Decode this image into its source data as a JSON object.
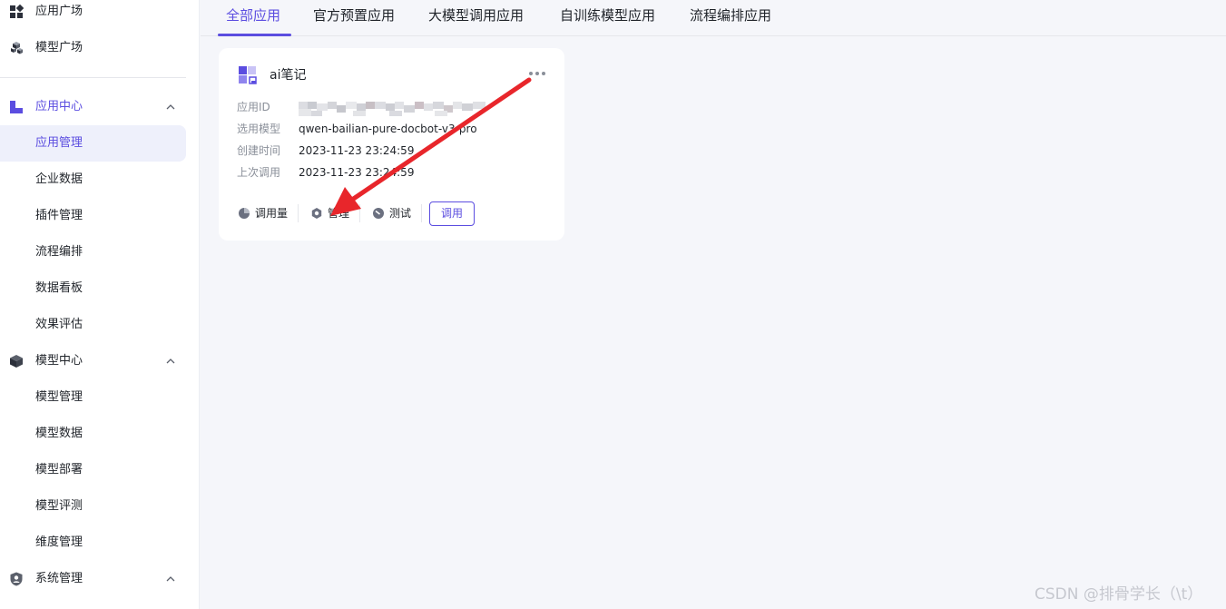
{
  "sidebar": {
    "top_items": [
      {
        "label": "应用广场",
        "icon": "grid-icon"
      },
      {
        "label": "模型广场",
        "icon": "cubes-icon"
      }
    ],
    "app_center": {
      "label": "应用中心",
      "icon": "app-center-icon",
      "expanded": true,
      "items": [
        "应用管理",
        "企业数据",
        "插件管理",
        "流程编排",
        "数据看板",
        "效果评估"
      ],
      "active": "应用管理"
    },
    "model_center": {
      "label": "模型中心",
      "icon": "cube-icon",
      "expanded": true,
      "items": [
        "模型管理",
        "模型数据",
        "模型部署",
        "模型评测",
        "维度管理"
      ]
    },
    "system": {
      "label": "系统管理",
      "icon": "shield-user-icon",
      "expanded": true
    }
  },
  "tabs": {
    "items": [
      "全部应用",
      "官方预置应用",
      "大模型调用应用",
      "自训练模型应用",
      "流程编排应用"
    ],
    "active": "全部应用"
  },
  "card": {
    "title": "ai笔记",
    "fields": [
      {
        "key": "应用ID",
        "value": ""
      },
      {
        "key": "选用模型",
        "value": "qwen-bailian-pure-docbot-v3-pro"
      },
      {
        "key": "创建时间",
        "value": "2023-11-23 23:24:59"
      },
      {
        "key": "上次调用",
        "value": "2023-11-23 23:24:59"
      }
    ],
    "actions": {
      "usage": "调用量",
      "manage": "管理",
      "test": "测试",
      "call": "调用"
    }
  },
  "colors": {
    "accent": "#5b4de0",
    "arrow": "#e8262b",
    "background": "#f5f6fa"
  },
  "watermark": "CSDN @排骨学长（\\t）"
}
